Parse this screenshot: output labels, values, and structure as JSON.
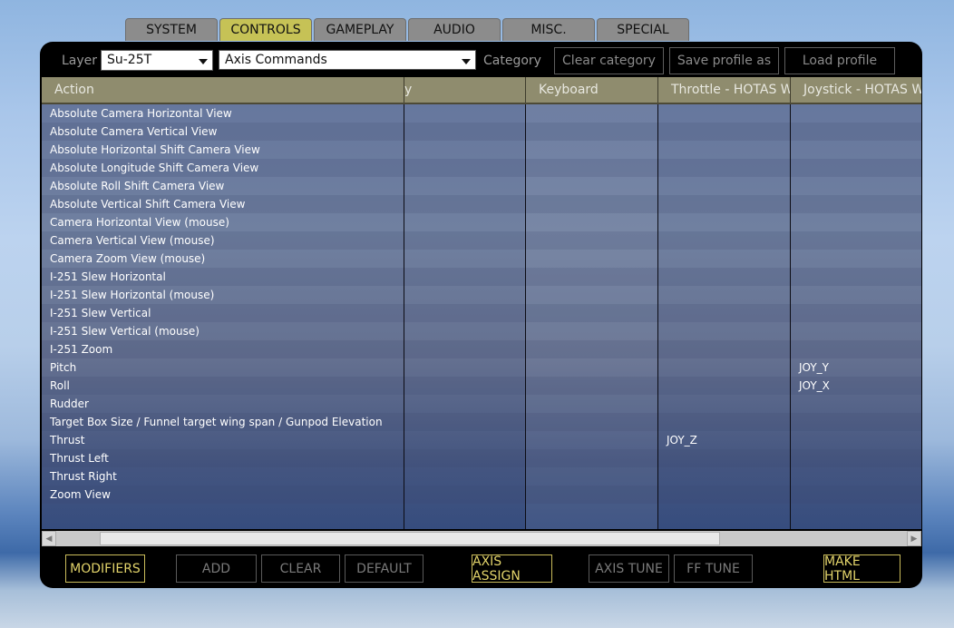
{
  "tabs": [
    "SYSTEM",
    "CONTROLS",
    "GAMEPLAY",
    "AUDIO",
    "MISC.",
    "SPECIAL"
  ],
  "active_tab": "CONTROLS",
  "toolbar": {
    "layer_label": "Layer",
    "layer_value": "Su-25T",
    "category_value": "Axis Commands",
    "category_label": "Category",
    "clear_category": "Clear category",
    "save_profile": "Save profile as",
    "load_profile": "Load profile"
  },
  "columns": [
    "Action",
    "y",
    "Keyboard",
    "Throttle - HOTAS Wa",
    "Joystick - HOTAS Wa"
  ],
  "rows": [
    {
      "action": "Absolute Camera Horizontal View",
      "throttle": "",
      "joystick": ""
    },
    {
      "action": "Absolute Camera Vertical View",
      "throttle": "",
      "joystick": ""
    },
    {
      "action": "Absolute Horizontal Shift Camera View",
      "throttle": "",
      "joystick": ""
    },
    {
      "action": "Absolute Longitude Shift Camera View",
      "throttle": "",
      "joystick": ""
    },
    {
      "action": "Absolute Roll Shift Camera View",
      "throttle": "",
      "joystick": ""
    },
    {
      "action": "Absolute Vertical Shift Camera View",
      "throttle": "",
      "joystick": ""
    },
    {
      "action": "Camera Horizontal View (mouse)",
      "throttle": "",
      "joystick": ""
    },
    {
      "action": "Camera Vertical View (mouse)",
      "throttle": "",
      "joystick": ""
    },
    {
      "action": "Camera Zoom View (mouse)",
      "throttle": "",
      "joystick": ""
    },
    {
      "action": "I-251 Slew Horizontal",
      "throttle": "",
      "joystick": ""
    },
    {
      "action": "I-251 Slew Horizontal (mouse)",
      "throttle": "",
      "joystick": ""
    },
    {
      "action": "I-251 Slew Vertical",
      "throttle": "",
      "joystick": ""
    },
    {
      "action": "I-251 Slew Vertical (mouse)",
      "throttle": "",
      "joystick": ""
    },
    {
      "action": "I-251 Zoom",
      "throttle": "",
      "joystick": ""
    },
    {
      "action": "Pitch",
      "throttle": "",
      "joystick": "JOY_Y"
    },
    {
      "action": "Roll",
      "throttle": "",
      "joystick": "JOY_X"
    },
    {
      "action": "Rudder",
      "throttle": "",
      "joystick": ""
    },
    {
      "action": "Target Box Size / Funnel target wing span / Gunpod Elevation",
      "throttle": "",
      "joystick": ""
    },
    {
      "action": "Thrust",
      "throttle": "JOY_Z",
      "joystick": ""
    },
    {
      "action": "Thrust Left",
      "throttle": "",
      "joystick": ""
    },
    {
      "action": "Thrust Right",
      "throttle": "",
      "joystick": ""
    },
    {
      "action": "Zoom View",
      "throttle": "",
      "joystick": ""
    }
  ],
  "buttons": {
    "modifiers": "MODIFIERS",
    "add": "ADD",
    "clear": "CLEAR",
    "default": "DEFAULT",
    "axis_assign": "AXIS ASSIGN",
    "axis_tune": "AXIS TUNE",
    "ff_tune": "FF TUNE",
    "make_html": "MAKE HTML"
  },
  "colors": {
    "active_tab": "#c6c256",
    "accent_button": "#e2d36a",
    "header": "#8f8c6e"
  }
}
